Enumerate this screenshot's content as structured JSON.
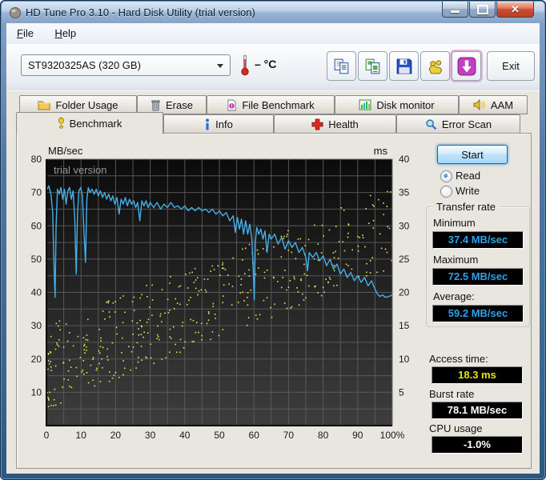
{
  "window": {
    "title": "HD Tune Pro 3.10 - Hard Disk Utility (trial version)"
  },
  "icons": {
    "close_glyph": "✕",
    "names": [
      "app-icon",
      "minimize-icon",
      "maximize-icon",
      "close-icon",
      "chevron-down-icon",
      "thermometer-icon",
      "copy-text-icon",
      "copy-screenshot-icon",
      "save-icon",
      "options-icon",
      "download-icon",
      "folder-icon",
      "erase-icon",
      "file-benchmark-icon",
      "disk-monitor-icon",
      "aam-speaker-icon",
      "benchmark-icon",
      "info-icon",
      "health-icon",
      "error-scan-icon"
    ]
  },
  "menu": {
    "items": [
      "File",
      "Help"
    ]
  },
  "toolbar": {
    "drive": "ST9320325AS (320 GB)",
    "temperature": "– °C",
    "exit_label": "Exit"
  },
  "tabs": {
    "row1": [
      {
        "label": "Folder Usage"
      },
      {
        "label": "Erase"
      },
      {
        "label": "File Benchmark"
      },
      {
        "label": "Disk monitor"
      },
      {
        "label": "AAM"
      }
    ],
    "row2": [
      {
        "label": "Benchmark"
      },
      {
        "label": "Info"
      },
      {
        "label": "Health"
      },
      {
        "label": "Error Scan"
      }
    ],
    "active": "Benchmark"
  },
  "panel": {
    "start_label": "Start",
    "read_label": "Read",
    "write_label": "Write",
    "read_selected": true,
    "transfer_rate_title": "Transfer rate",
    "minimum_label": "Minimum",
    "minimum_value": "37.4 MB/sec",
    "maximum_label": "Maximum",
    "maximum_value": "72.5 MB/sec",
    "average_label": "Average:",
    "average_value": "59.2 MB/sec",
    "access_time_label": "Access time:",
    "access_time_value": "18.3 ms",
    "burst_rate_label": "Burst rate",
    "burst_rate_value": "78.1 MB/sec",
    "cpu_usage_label": "CPU usage",
    "cpu_usage_value": "-1.0%"
  },
  "colors": {
    "transfer_line": "#46aee6",
    "access_dots": "#e6e65a",
    "value_blue": "#2da2e8",
    "value_yellow": "#e6e600",
    "plot_grid": "#5d5d5d"
  },
  "chart_data": {
    "type": [
      "line",
      "scatter"
    ],
    "overlay_text": "trial version",
    "grid_step": 5,
    "x_axis": {
      "range": [
        0,
        100
      ],
      "ticks": [
        "0",
        "10",
        "20",
        "30",
        "40",
        "50",
        "60",
        "70",
        "80",
        "90",
        "100%"
      ]
    },
    "left_axis": {
      "label": "MB/sec",
      "range": [
        0,
        80
      ],
      "ticks": [
        80,
        70,
        60,
        50,
        40,
        30,
        20,
        10
      ]
    },
    "right_axis": {
      "label": "ms",
      "range": [
        0,
        40
      ],
      "ticks": [
        40,
        35,
        30,
        25,
        20,
        15,
        10,
        5
      ]
    },
    "series": [
      {
        "name": "transfer-rate",
        "type": "line",
        "axis": "left",
        "unit": "MB/sec",
        "color": "#46aee6",
        "points": [
          [
            0,
            70.5
          ],
          [
            0.7,
            72
          ],
          [
            1.3,
            69.5
          ],
          [
            1.8,
            64
          ],
          [
            2.2,
            48
          ],
          [
            2.5,
            38.5
          ],
          [
            2.8,
            60
          ],
          [
            3.2,
            71
          ],
          [
            3.7,
            69.5
          ],
          [
            4.2,
            71.5
          ],
          [
            4.7,
            68
          ],
          [
            5.2,
            71
          ],
          [
            5.7,
            66.5
          ],
          [
            6.2,
            70.5
          ],
          [
            6.7,
            71.5
          ],
          [
            7.2,
            68
          ],
          [
            7.7,
            70.5
          ],
          [
            8.2,
            62
          ],
          [
            8.6,
            45.5
          ],
          [
            9,
            64
          ],
          [
            9.4,
            70.5
          ],
          [
            9.9,
            71.5
          ],
          [
            10.4,
            69
          ],
          [
            10.9,
            57
          ],
          [
            11.3,
            49
          ],
          [
            11.7,
            68
          ],
          [
            12.1,
            71.5
          ],
          [
            12.6,
            70
          ],
          [
            13.2,
            71
          ],
          [
            13.8,
            69.5
          ],
          [
            14.4,
            71
          ],
          [
            15,
            69
          ],
          [
            15.6,
            70.5
          ],
          [
            16.2,
            68.5
          ],
          [
            16.8,
            70
          ],
          [
            17.4,
            68
          ],
          [
            18,
            69.5
          ],
          [
            18.6,
            67.5
          ],
          [
            19.2,
            69
          ],
          [
            19.8,
            66.5
          ],
          [
            20.4,
            68.5
          ],
          [
            21,
            63.5
          ],
          [
            21.6,
            68
          ],
          [
            22.2,
            66.5
          ],
          [
            22.8,
            68.5
          ],
          [
            23.4,
            66
          ],
          [
            24,
            68
          ],
          [
            24.6,
            66.5
          ],
          [
            25.2,
            67.5
          ],
          [
            25.8,
            65.5
          ],
          [
            26.4,
            67
          ],
          [
            27,
            61.5
          ],
          [
            27.6,
            67.5
          ],
          [
            28.2,
            66
          ],
          [
            28.8,
            67.5
          ],
          [
            29.4,
            65.5
          ],
          [
            30,
            67
          ],
          [
            31,
            65.5
          ],
          [
            32,
            67
          ],
          [
            33,
            65
          ],
          [
            34,
            66.5
          ],
          [
            35,
            65.5
          ],
          [
            36,
            67
          ],
          [
            37,
            65.5
          ],
          [
            38,
            66
          ],
          [
            39,
            65
          ],
          [
            40,
            66
          ],
          [
            41,
            64.5
          ],
          [
            42,
            65.5
          ],
          [
            43,
            64.5
          ],
          [
            44,
            65.5
          ],
          [
            45,
            64.5
          ],
          [
            46,
            65
          ],
          [
            47,
            64
          ],
          [
            48,
            65
          ],
          [
            49,
            63.5
          ],
          [
            50,
            64.5
          ],
          [
            51,
            63
          ],
          [
            52,
            64
          ],
          [
            53,
            61.5
          ],
          [
            54,
            63
          ],
          [
            54.6,
            58
          ],
          [
            55.2,
            62.5
          ],
          [
            55.8,
            59
          ],
          [
            56.4,
            62
          ],
          [
            57,
            57.5
          ],
          [
            57.6,
            61.5
          ],
          [
            58.2,
            57.5
          ],
          [
            58.8,
            60.5
          ],
          [
            59.4,
            56
          ],
          [
            59.8,
            47
          ],
          [
            60.1,
            37.8
          ],
          [
            60.4,
            55
          ],
          [
            60.8,
            59.5
          ],
          [
            61.4,
            57.5
          ],
          [
            62,
            59
          ],
          [
            62.6,
            56
          ],
          [
            63.2,
            58.5
          ],
          [
            63.8,
            52
          ],
          [
            64.4,
            57.5
          ],
          [
            65,
            56
          ],
          [
            66,
            57.5
          ],
          [
            67,
            54.5
          ],
          [
            68,
            56.5
          ],
          [
            69,
            53
          ],
          [
            70,
            55.5
          ],
          [
            71,
            53.5
          ],
          [
            72,
            55
          ],
          [
            73,
            52
          ],
          [
            74,
            53.5
          ],
          [
            75,
            50.5
          ],
          [
            75.5,
            46.5
          ],
          [
            76,
            52
          ],
          [
            77,
            50.5
          ],
          [
            78,
            52
          ],
          [
            79,
            49.5
          ],
          [
            80,
            51
          ],
          [
            81,
            48
          ],
          [
            82,
            50
          ],
          [
            83,
            47
          ],
          [
            84,
            48.5
          ],
          [
            85,
            45.5
          ],
          [
            86,
            47
          ],
          [
            87,
            44.5
          ],
          [
            88,
            46
          ],
          [
            89,
            43.5
          ],
          [
            90,
            45
          ],
          [
            91,
            43
          ],
          [
            92,
            44.5
          ],
          [
            93,
            42
          ],
          [
            94,
            43.5
          ],
          [
            95,
            41
          ],
          [
            95.7,
            39.5
          ],
          [
            96.4,
            38.8
          ],
          [
            97.2,
            39.2
          ],
          [
            98,
            38.5
          ],
          [
            99,
            38.8
          ],
          [
            100,
            39.2
          ]
        ]
      },
      {
        "name": "access-time",
        "type": "scatter",
        "axis": "right",
        "unit": "ms",
        "color": "#e6e65a",
        "generator": {
          "count": 420,
          "seed": 11,
          "x_skew": 1.35,
          "base_ms": 2.5,
          "slope_ms_per_pct": 0.21,
          "spread_ms": 12.5,
          "max_ms": 36
        }
      }
    ]
  }
}
